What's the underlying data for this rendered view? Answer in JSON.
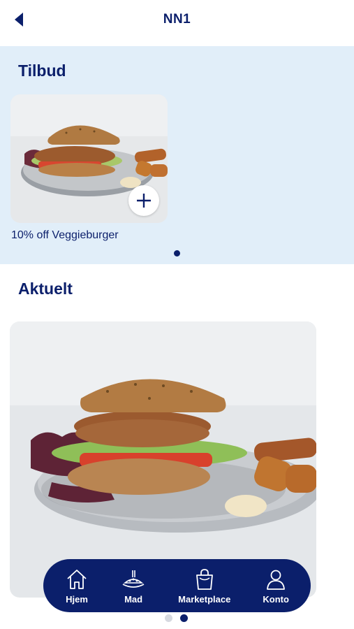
{
  "header": {
    "title": "NN1"
  },
  "tilbud": {
    "title": "Tilbud",
    "offers": [
      {
        "caption": "10% off Veggieburger"
      }
    ]
  },
  "aktuelt": {
    "title": "Aktuelt"
  },
  "nav": {
    "items": [
      {
        "label": "Hjem",
        "icon": "home-icon"
      },
      {
        "label": "Mad",
        "icon": "food-plate-icon"
      },
      {
        "label": "Marketplace",
        "icon": "shopping-bag-icon"
      },
      {
        "label": "Konto",
        "icon": "person-icon"
      }
    ]
  },
  "pager": {
    "count": 2,
    "active": 2
  },
  "colors": {
    "primary": "#0b1f6b",
    "tilbud_bg": "#e1eef9"
  }
}
